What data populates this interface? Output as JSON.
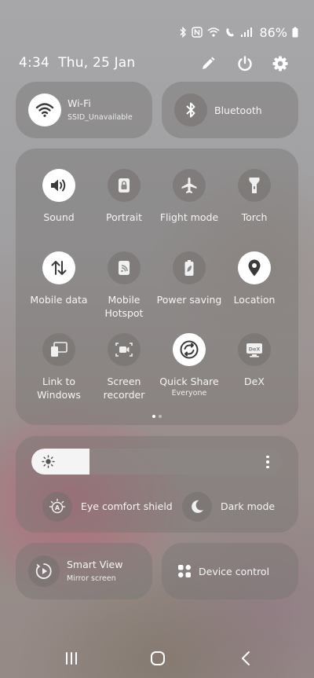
{
  "status_bar": {
    "battery_text": "86%",
    "icons": [
      "bluetooth-icon",
      "nfc-icon",
      "wifi-calling-icon",
      "volte-icon",
      "signal-icon",
      "battery-icon"
    ]
  },
  "header": {
    "time": "4:34",
    "date": "Thu, 25 Jan",
    "icons": [
      "edit-icon",
      "power-icon",
      "settings-icon"
    ]
  },
  "top_tiles": {
    "wifi": {
      "label": "Wi-Fi",
      "sublabel": "SSID_Unavailable",
      "active": true,
      "icon": "wifi-icon"
    },
    "bluetooth": {
      "label": "Bluetooth",
      "active": false,
      "icon": "bluetooth-icon"
    }
  },
  "grid": {
    "tiles": [
      {
        "label": "Sound",
        "icon": "sound-icon",
        "active": true
      },
      {
        "label": "Portrait",
        "icon": "portrait-lock-icon",
        "active": false
      },
      {
        "label": "Flight mode",
        "icon": "airplane-icon",
        "active": false
      },
      {
        "label": "Torch",
        "icon": "torch-icon",
        "active": false
      },
      {
        "label": "Mobile data",
        "icon": "mobile-data-icon",
        "active": true
      },
      {
        "label": "Mobile Hotspot",
        "icon": "hotspot-icon",
        "active": false
      },
      {
        "label": "Power saving",
        "icon": "power-saving-icon",
        "active": false
      },
      {
        "label": "Location",
        "icon": "location-icon",
        "active": true
      },
      {
        "label": "Link to Windows",
        "icon": "link-to-windows-icon",
        "active": false
      },
      {
        "label": "Screen recorder",
        "icon": "screen-recorder-icon",
        "active": false
      },
      {
        "label": "Quick Share",
        "sublabel": "Everyone",
        "icon": "quick-share-icon",
        "active": true
      },
      {
        "label": "DeX",
        "icon": "dex-icon",
        "active": false
      }
    ],
    "page_count": 2,
    "current_page": 1
  },
  "display": {
    "brightness_level": 0.23,
    "eye_comfort_label": "Eye comfort shield",
    "dark_mode_label": "Dark mode"
  },
  "bottom_tiles": {
    "smart_view": {
      "label": "Smart View",
      "sublabel": "Mirror screen",
      "icon": "smart-view-icon"
    },
    "device_control": {
      "label": "Device control",
      "icon": "device-control-icon"
    }
  },
  "nav": {
    "icons": [
      "recents-icon",
      "home-icon",
      "back-icon"
    ]
  }
}
